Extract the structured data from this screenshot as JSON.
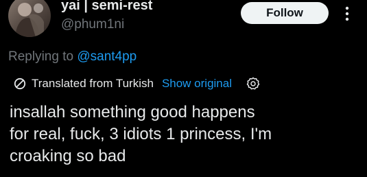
{
  "author": {
    "display_name": "yai | semi-rest",
    "handle": "@phum1ni"
  },
  "actions": {
    "follow_label": "Follow",
    "more_icon": "more-vertical-icon"
  },
  "reply": {
    "prefix": "Replying to ",
    "mention": "@sant4pp"
  },
  "translation": {
    "icon": "translate-icon",
    "label": "Translated from Turkish",
    "show_original_label": "Show original",
    "settings_icon": "gear-icon"
  },
  "tweet": {
    "text": "insallah something good happens\nfor real, fuck, 3 idiots 1 princess, I'm\ncroaking so bad"
  },
  "colors": {
    "background": "#000000",
    "primary_text": "#e7e9ea",
    "secondary_text": "#71767b",
    "accent": "#1d9bf0",
    "follow_button_bg": "#eff3f4"
  }
}
